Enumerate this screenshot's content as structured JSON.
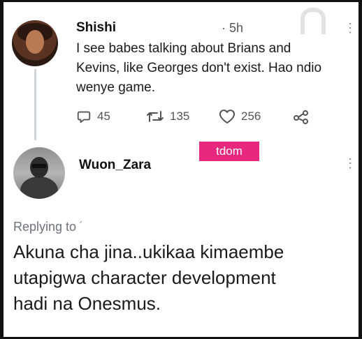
{
  "tweet": {
    "author": "Shishi",
    "time": "5h",
    "text_lines": [
      "I see babes talking about Brians and",
      "Kevins, like Georges don't exist. Hao ndio",
      "wenye game."
    ],
    "reply_count": "45",
    "retweet_count": "135",
    "like_count": "256"
  },
  "reply": {
    "author": "Wuon_Zara",
    "tag": "tdom",
    "replying_label": "Replying to",
    "text_lines": [
      "Akuna cha jina..ukikaa kimaembe",
      "utapigwa character development",
      "hadi na Onesmus."
    ]
  },
  "icons": {
    "reply": "comment-icon",
    "retweet": "retweet-icon",
    "like": "heart-icon",
    "share": "share-icon",
    "more": "more-vertical-icon"
  },
  "colors": {
    "tag_background": "#e8287f",
    "action_gray": "#555555",
    "muted_text": "#6b7278"
  }
}
